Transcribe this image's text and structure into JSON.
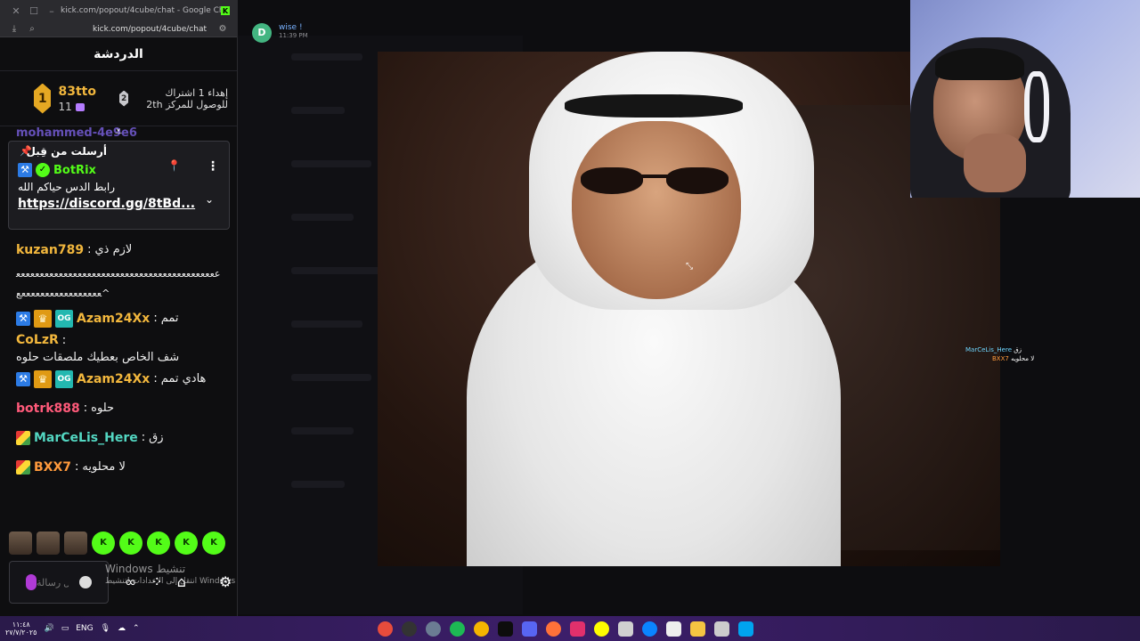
{
  "chrome": {
    "title": "kick.com/popout/4cube/chat - Google Chrome",
    "url": "kick.com/popout/4cube/chat"
  },
  "chat": {
    "header": "الدردشة",
    "leaderboard": {
      "first_rank": "1",
      "first_name": "83tto",
      "first_count": "11",
      "second_rank": "2",
      "next_text": "إهداء 1 اشتراك للوصول للمركز 2th"
    },
    "peek_user": "mohammed-4e9e6",
    "pinned": {
      "header": "أرسلت من قِبل",
      "username": "BotRix",
      "message": "رابط الدس حياكم الله",
      "link": "https://discord.gg/8tBd..."
    },
    "messages": [
      {
        "user": "kuzan789",
        "color": "#f2b73d",
        "text": "لازم ذي"
      },
      {
        "user": "Azam24Xx",
        "color": "#f2b73d",
        "text": "تمم"
      },
      {
        "user": "CoLzR",
        "color": "#f2b73d",
        "text": "شف الخاص بعطيك ملصقات حلوه"
      },
      {
        "user": "Azam24Xx",
        "color": "#f2b73d",
        "text": "هادي تمم"
      },
      {
        "user": "botrk888",
        "color": "#ff5a7a",
        "text": "حلوه"
      },
      {
        "user": "MarCeLis_Here",
        "color": "#53d7c2",
        "text": "زق"
      },
      {
        "user": "BXX7",
        "color": "#ff9a3c",
        "text": "لا محلويه"
      }
    ],
    "long_text": "ععععععععععععععععععععععععععععععععععععععععععععععععععععععععععععع^",
    "input_placeholder": "ارسال رسالة",
    "watermark_title": "Windows تنشيط",
    "watermark_sub": "انتقل إلى الإعدادات لتنشيط Windows"
  },
  "discord": {
    "sender": "wise !",
    "time": "11:39 PM"
  },
  "overlay": {
    "user1": "MarCeLis_Here",
    "text1": "زق",
    "user2": "BXX7",
    "text2": "لا محلويه"
  },
  "taskbar": {
    "time": "١١:٤٨",
    "date": "٢٧/٧/٢٠٢٥",
    "lang": "ENG"
  }
}
